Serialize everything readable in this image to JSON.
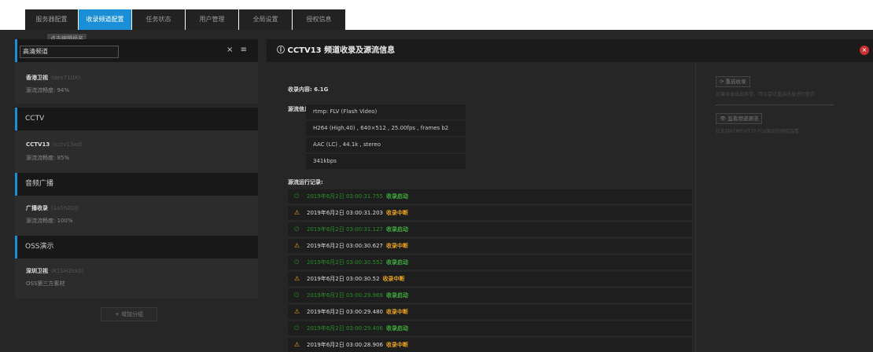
{
  "tabs": [
    "服务器配置",
    "收录频道配置",
    "任务状态",
    "用户管理",
    "全局设置",
    "授权信息"
  ],
  "tooltip": "点击编辑组名",
  "sidebar": {
    "edit_value": "高清频道",
    "close_glyph": "×",
    "menu_glyph": "≡",
    "group1_channel": {
      "name": "香港卫视",
      "id": "(dev71UX)",
      "sub": "源流流畅度: 94%"
    },
    "groups": [
      {
        "title": "CCTV",
        "channel": {
          "name": "CCTV13",
          "id": "(cctv13xd)",
          "sub": "源流流畅度: 85%"
        }
      },
      {
        "title": "音频广播",
        "channel": {
          "name": "广播收录",
          "id": "(1a1h2Dj)",
          "sub": "源流流畅度: 100%"
        }
      },
      {
        "title": "OSS演示",
        "channel": {
          "name": "深圳卫视",
          "id": "(K1SH2ex0)",
          "sub": "OSS第三方素材"
        }
      }
    ],
    "add_group": "+ 增加分组"
  },
  "main": {
    "title": "CCTV13 频道收录及源流信息",
    "info_icon": "info-icon",
    "record_label": "收录内容:",
    "record_value": "6.1G",
    "source_label": "源流信息:",
    "source_lines": [
      "rtmp: FLV (Flash Video)",
      "H264 (High,40) , 640×512 , 25.00fps , frames b2",
      "AAC (LC) , 44.1k , stereo",
      "341kbps"
    ],
    "log_label": "源流运行记录:",
    "logs": [
      {
        "type": "ok",
        "time": "2019年6月2日 03:00:31.755",
        "event": "收录启动"
      },
      {
        "type": "warn",
        "time": "2019年6月2日 03:00:31.203",
        "event": "收录中断"
      },
      {
        "type": "ok",
        "time": "2019年6月2日 03:00:31.127",
        "event": "收录启动"
      },
      {
        "type": "warn",
        "time": "2019年6月2日 03:00:30.627",
        "event": "收录中断"
      },
      {
        "type": "ok",
        "time": "2019年6月2日 03:00:30.552",
        "event": "收录启动"
      },
      {
        "type": "warn",
        "time": "2019年6月2日 03:00:30.52",
        "event": "收录中断"
      },
      {
        "type": "ok",
        "time": "2019年6月2日 03:00:29.969",
        "event": "收录启动"
      },
      {
        "type": "warn",
        "time": "2019年6月2日 03:00:29.480",
        "event": "收录中断"
      },
      {
        "type": "ok",
        "time": "2019年6月2日 03:00:29.406",
        "event": "收录启动"
      },
      {
        "type": "warn",
        "time": "2019年6月2日 03:00:28.906",
        "event": "收录中断"
      }
    ]
  },
  "right": {
    "restart_btn": "⟳ 重启收录",
    "restart_note": "如果收录出现异常，可以尝试重启收录进行修正",
    "monitor_btn": "👁 监看频道源流",
    "monitor_note": "仅支持RTMP/HTTP-FLV源流的预览监看"
  },
  "colors": {
    "accent": "#1a8fd6",
    "ok": "#3fae3f",
    "warn": "#e8a21c",
    "danger": "#c83232"
  }
}
